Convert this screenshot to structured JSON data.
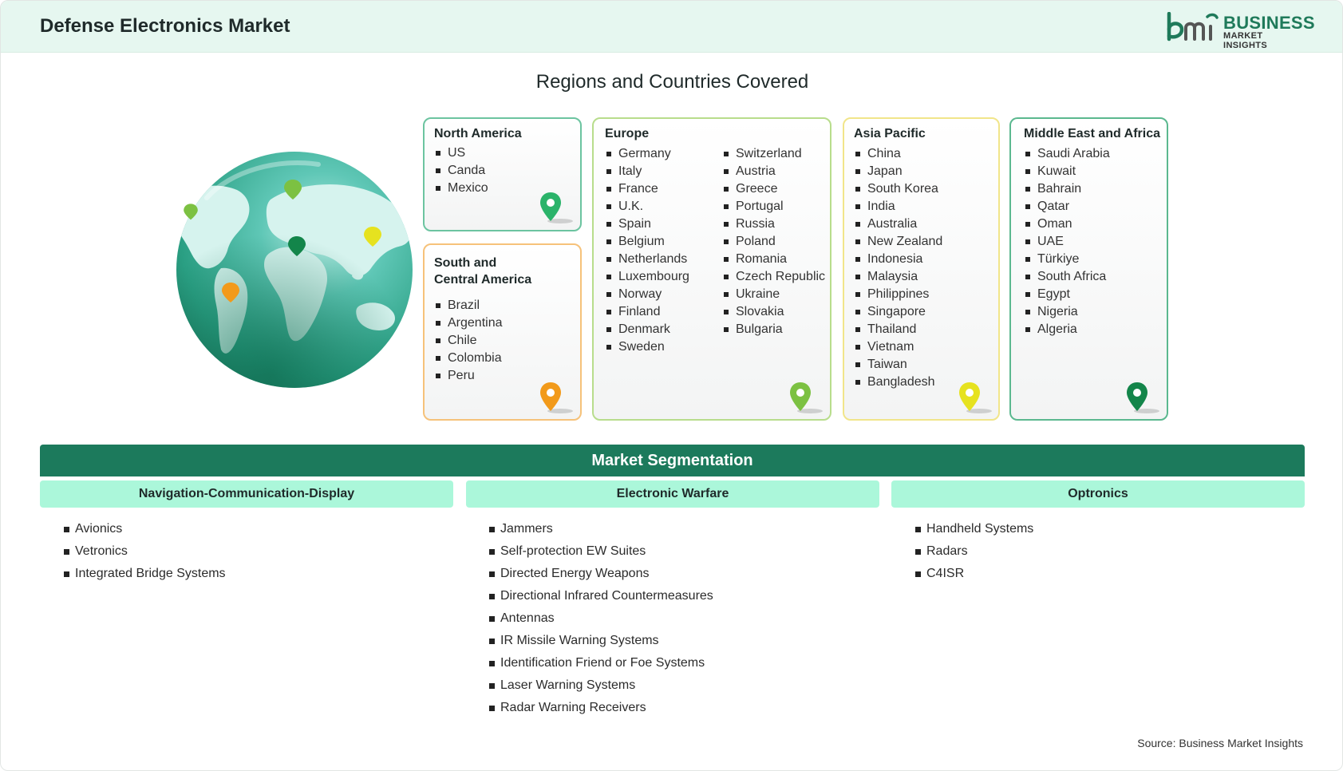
{
  "header": {
    "title": "Defense Electronics Market",
    "logo": {
      "word1": "BUSINESS",
      "word2": "MARKET INSIGHTS",
      "mark_text": "bmi"
    }
  },
  "regions_section": {
    "title": "Regions and Countries Covered",
    "regions": [
      {
        "name": "North America",
        "color": "#6cc4a0",
        "pin_color": "#2bb36a",
        "countries": [
          "US",
          "Canda",
          "Mexico"
        ]
      },
      {
        "name": "South and Central America",
        "name_line1": "South and",
        "name_line2": "Central America",
        "color": "#f6c27a",
        "pin_color": "#f29a1a",
        "countries": [
          "Brazil",
          "Argentina",
          "Chile",
          "Colombia",
          "Peru"
        ]
      },
      {
        "name": "Europe",
        "color": "#b8dd8c",
        "pin_color": "#7cc142",
        "countries_col1": [
          "Germany",
          "Italy",
          "France",
          "U.K.",
          "Spain",
          "Belgium",
          "Netherlands",
          "Luxembourg",
          "Norway",
          "Finland",
          "Denmark",
          "Sweden"
        ],
        "countries_col2": [
          "Switzerland",
          "Austria",
          "Greece",
          "Portugal",
          "Russia",
          "Poland",
          "Romania",
          "Czech Republic",
          "Ukraine",
          "Slovakia",
          "Bulgaria"
        ]
      },
      {
        "name": "Asia Pacific",
        "color": "#f1e58a",
        "pin_color": "#d9d61c",
        "countries": [
          "China",
          "Japan",
          "South Korea",
          "India",
          "Australia",
          "New Zealand",
          "Indonesia",
          "Malaysia",
          "Philippines",
          "Singapore",
          "Thailand",
          "Vietnam",
          "Taiwan",
          "Bangladesh"
        ]
      },
      {
        "name": "Middle East and Africa",
        "color": "#5bb88f",
        "pin_color": "#13854a",
        "countries": [
          "Saudi Arabia",
          "Kuwait",
          "Bahrain",
          "Qatar",
          "Oman",
          "UAE",
          "Türkiye",
          "South Africa",
          "Egypt",
          "Nigeria",
          "Algeria"
        ]
      }
    ]
  },
  "segmentation": {
    "title": "Market Segmentation",
    "columns": [
      {
        "heading": "Navigation-Communication-Display",
        "items": [
          "Avionics",
          "Vetronics",
          "Integrated Bridge Systems"
        ]
      },
      {
        "heading": "Electronic Warfare",
        "items": [
          "Jammers",
          "Self-protection EW Suites",
          "Directed Energy Weapons",
          "Directional Infrared Countermeasures",
          "Antennas",
          "IR Missile Warning Systems",
          "Identification Friend or Foe Systems",
          "Laser Warning Systems",
          "Radar Warning Receivers"
        ]
      },
      {
        "heading": "Optronics",
        "items": [
          "Handheld Systems",
          "Radars",
          "C4ISR"
        ]
      }
    ]
  },
  "footer": {
    "source": "Source: Business Market Insights"
  },
  "colors": {
    "brand_green": "#1c7a5c",
    "header_bg": "#e6f7f0",
    "column_head_bg": "#abf7da"
  }
}
